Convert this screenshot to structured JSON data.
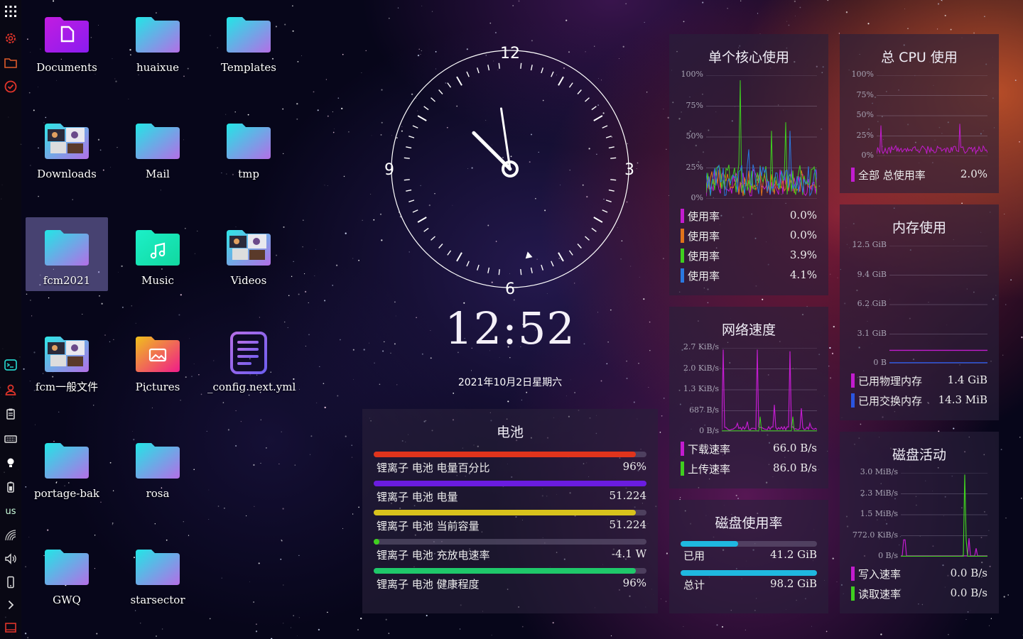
{
  "dock": {
    "items": [
      "apps-grid-icon",
      "settings-gear-icon",
      "folder-icon",
      "todo-check-icon"
    ],
    "lower_items": [
      "terminal-icon",
      "user-icon",
      "clipboard-icon",
      "keyboard-icon",
      "bulb-icon",
      "battery-icon"
    ],
    "keyboard_layout": "us",
    "tray_items": [
      "wifi-icon",
      "volume-icon",
      "phone-icon",
      "chevron-right-icon",
      "monitor-icon"
    ]
  },
  "desktop": {
    "icons": [
      {
        "label": "Documents",
        "icon": "folder-documents-icon"
      },
      {
        "label": "huaixue",
        "icon": "folder-icon"
      },
      {
        "label": "Templates",
        "icon": "folder-icon"
      },
      {
        "label": "Downloads",
        "icon": "folder-thumbnail-icon"
      },
      {
        "label": "Mail",
        "icon": "folder-icon"
      },
      {
        "label": "tmp",
        "icon": "folder-icon"
      },
      {
        "label": "fcm2021",
        "icon": "folder-icon"
      },
      {
        "label": "Music",
        "icon": "folder-music-icon"
      },
      {
        "label": "Videos",
        "icon": "folder-thumbnail-icon"
      },
      {
        "label": "fcm一般文件",
        "icon": "folder-thumbnail-icon"
      },
      {
        "label": "Pictures",
        "icon": "folder-pictures-icon"
      },
      {
        "label": "_config.next.yml",
        "icon": "text-file-icon"
      },
      {
        "label": "portage-bak",
        "icon": "folder-icon"
      },
      {
        "label": "rosa",
        "icon": "folder-icon"
      },
      {
        "label": "GWQ",
        "icon": "folder-icon"
      },
      {
        "label": "starsector",
        "icon": "folder-icon"
      }
    ]
  },
  "clock": {
    "numerals": [
      "12",
      "3",
      "6",
      "9"
    ],
    "hour": 12,
    "minute": 52,
    "second": 28,
    "time": "12:52",
    "date": "2021年10月2日星期六"
  },
  "core_usage": {
    "title": "单个核心使用",
    "y_ticks": [
      "100%",
      "75%",
      "50%",
      "25%",
      "0%"
    ],
    "series": [
      {
        "label": "使用率",
        "value": "0.0%",
        "color": "#c21ccf"
      },
      {
        "label": "使用率",
        "value": "0.0%",
        "color": "#e0731b"
      },
      {
        "label": "使用率",
        "value": "3.9%",
        "color": "#3fcf1f"
      },
      {
        "label": "使用率",
        "value": "4.1%",
        "color": "#2a78e0"
      }
    ]
  },
  "cpu_total": {
    "title": "总 CPU 使用",
    "y_ticks": [
      "100%",
      "75%",
      "50%",
      "25%",
      "0%"
    ],
    "series": [
      {
        "label": "全部 总使用率",
        "value": "2.0%",
        "color": "#c21ccf"
      }
    ]
  },
  "memory": {
    "title": "内存使用",
    "y_ticks": [
      "12.5 GiB",
      "9.4 GiB",
      "6.2 GiB",
      "3.1 GiB",
      "0 B"
    ],
    "series": [
      {
        "label": "已用物理内存",
        "value": "1.4 GiB",
        "color": "#c21ccf"
      },
      {
        "label": "已用交换内存",
        "value": "14.3 MiB",
        "color": "#2a55e0"
      }
    ]
  },
  "network": {
    "title": "网络速度",
    "y_ticks": [
      "2.7 KiB/s",
      "2.0 KiB/s",
      "1.3 KiB/s",
      "687 B/s",
      "0 B/s"
    ],
    "series": [
      {
        "label": "下载速率",
        "value": "66.0 B/s",
        "color": "#c21ccf"
      },
      {
        "label": "上传速率",
        "value": "86.0 B/s",
        "color": "#3fcf1f"
      }
    ]
  },
  "disk_usage": {
    "title": "磁盘使用率",
    "used_label": "已用",
    "used_value": "41.2 GiB",
    "total_label": "总计",
    "total_value": "98.2 GiB",
    "used_fraction": 0.42,
    "color": "#1fb8e0"
  },
  "disk_activity": {
    "title": "磁盘活动",
    "y_ticks": [
      "3.0 MiB/s",
      "2.3 MiB/s",
      "1.5 MiB/s",
      "772.0 KiB/s",
      "0 B/s"
    ],
    "series": [
      {
        "label": "写入速率",
        "value": "0.0 B/s",
        "color": "#c21ccf"
      },
      {
        "label": "读取速率",
        "value": "0.0 B/s",
        "color": "#3fcf1f"
      }
    ]
  },
  "battery": {
    "title": "电池",
    "bars": [
      {
        "label": "锂离子 电池 电量百分比",
        "value": "96%",
        "fraction": 0.96,
        "color": "#e0341c"
      },
      {
        "label": "锂离子 电池 电量",
        "value": "51.224",
        "fraction": 1.0,
        "color": "#6a1ce0"
      },
      {
        "label": "锂离子 电池 当前容量",
        "value": "51.224",
        "fraction": 0.96,
        "color": "#d8c21c"
      },
      {
        "label": "锂离子 电池 充放电速率",
        "value": "-4.1 W",
        "fraction": 0.02,
        "color": "#3fcf1f"
      },
      {
        "label": "锂离子 电池 健康程度",
        "value": "96%",
        "fraction": 0.96,
        "color": "#1fc86a"
      }
    ]
  }
}
